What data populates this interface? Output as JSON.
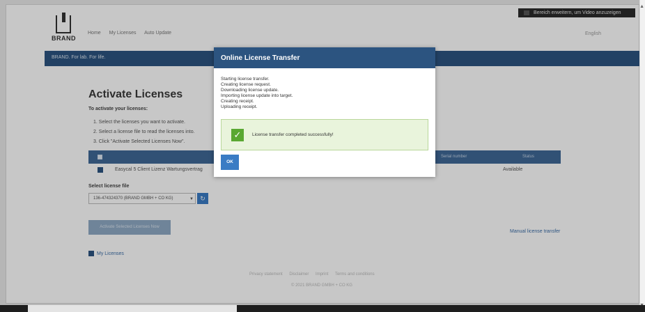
{
  "fullscreen_toast": "Bereich erweitern, um Video anzuzeigen",
  "header": {
    "logo_text": "BRAND",
    "nav": [
      "Home",
      "My Licenses",
      "Auto Update"
    ],
    "language": "English",
    "tagline": "BRAND. For lab. For life."
  },
  "main": {
    "title": "Activate Licenses",
    "intro": "To activate your licenses:",
    "steps": [
      "1. Select the licenses you want to activate.",
      "2. Select a license file to read the licenses into.",
      "3. Click \"Activate Selected Licenses Now\"."
    ],
    "table": {
      "col_serial": "Serial number",
      "col_status": "Status",
      "rows": [
        {
          "name": "Easycal 5 Client Lizenz Wartungsvertrag",
          "status": "Available"
        }
      ]
    },
    "select_label": "Select license file",
    "select_value": "136-474324370 (BRAND GMBH + CO KG)",
    "activate_button": "Activate Selected Licenses Now",
    "manual_link": "Manual license transfer",
    "my_licenses": "My Licenses"
  },
  "footer": {
    "links": [
      "Privacy statement",
      "Disclaimer",
      "Imprint",
      "Terms and conditions"
    ],
    "copyright": "© 2021 BRAND GMBH + CO KG"
  },
  "modal": {
    "title": "Online License Transfer",
    "log": [
      "Starting license transfer.",
      "Creating license request.",
      "Downloading license update.",
      "Importing license update into target.",
      "Creating receipt.",
      "Uploading receipt."
    ],
    "success_message": "License transfer completed successfully!",
    "ok_label": "OK"
  },
  "colors": {
    "brand_blue": "#2c5480",
    "button_blue": "#3a7cc4",
    "success_green": "#5aa832"
  }
}
